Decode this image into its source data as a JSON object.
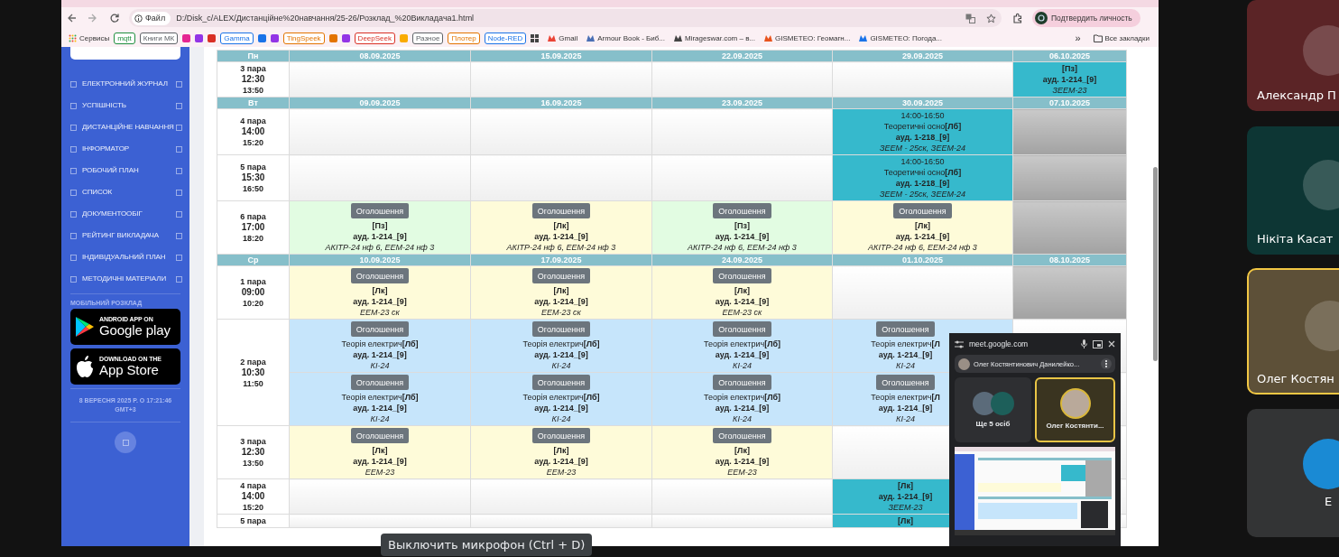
{
  "browser": {
    "address": {
      "chip": "Файл",
      "url": "D:/Disk_c/ALEX/Дистанційне%20навчання/25-26/Розклад_%20Викладача1.html"
    },
    "profile_button": "Подтвердить личность",
    "bookmarks": [
      {
        "kind": "apps",
        "label": "Сервисы"
      },
      {
        "kind": "chip",
        "label": "mqtt",
        "color": "#1e8e3e"
      },
      {
        "kind": "chip",
        "label": "Книги МК",
        "color": "#5f6368"
      },
      {
        "kind": "square",
        "color": "#e52592"
      },
      {
        "kind": "square",
        "color": "#9334e6"
      },
      {
        "kind": "square",
        "color": "#d93025"
      },
      {
        "kind": "chip",
        "label": "Gamma",
        "color": "#1a73e8"
      },
      {
        "kind": "square",
        "color": "#1a73e8"
      },
      {
        "kind": "square",
        "color": "#9334e6"
      },
      {
        "kind": "chip",
        "label": "TingSpeek",
        "color": "#e37400"
      },
      {
        "kind": "square",
        "color": "#e37400"
      },
      {
        "kind": "square",
        "color": "#9334e6"
      },
      {
        "kind": "chip",
        "label": "DeepSeek",
        "color": "#d93025"
      },
      {
        "kind": "square",
        "color": "#f9ab00"
      },
      {
        "kind": "chip",
        "label": "Разное",
        "color": "#5f6368"
      },
      {
        "kind": "chip",
        "label": "Плотер",
        "color": "#e37400"
      },
      {
        "kind": "chip",
        "label": "Node-RED",
        "color": "#1a73e8"
      },
      {
        "kind": "grid"
      },
      {
        "kind": "link",
        "label": "Gmail",
        "color": "#ea4335"
      },
      {
        "kind": "link",
        "label": "Armour Book - Биб...",
        "color": "#4a6fb5"
      },
      {
        "kind": "link",
        "label": "Mirageswar.com – в...",
        "color": "#444444"
      },
      {
        "kind": "link",
        "label": "GISMETEO: Геомагн...",
        "color": "#e8541e"
      },
      {
        "kind": "link",
        "label": "GISMETEO: Погода...",
        "color": "#1a73e8"
      }
    ],
    "overflow": "»",
    "all_bookmarks": "Все закладки"
  },
  "sidebar": {
    "items": [
      "ЕЛЕКТРОННИЙ ЖУРНАЛ",
      "УСПІШНІСТЬ",
      "ДИСТАНЦІЙНЕ НАВЧАННЯ",
      "ІНФОРМАТОР",
      "РОБОЧИЙ ПЛАН",
      "СПИСОК",
      "ДОКУМЕНТООБІГ",
      "РЕЙТИНГ ВИКЛАДАЧА",
      "ІНДИВІДУАЛЬНИЙ ПЛАН",
      "МЕТОДИЧНІ МАТЕРІАЛИ"
    ],
    "mobile_heading": "МОБІЛЬНИЙ РОЗКЛАД",
    "badges": [
      {
        "kind": "google",
        "small": "ANDROID APP ON",
        "big": "Google play"
      },
      {
        "kind": "apple",
        "small": "DOWNLOAD ON THE",
        "big": "App Store"
      }
    ],
    "datetime": [
      "8 ВЕРЕСНЯ 2025 Р. О 17:21:46",
      "GMT+3"
    ]
  },
  "table": {
    "sections": [
      {
        "day": "Пн",
        "dates": [
          "08.09.2025",
          "15.09.2025",
          "22.09.2025",
          "29.09.2025",
          "06.10.2025"
        ],
        "rows": [
          {
            "label": [
              "3 пара",
              "12:30",
              "13:50"
            ],
            "cells": [
              {
                "kind": "empty"
              },
              {
                "kind": "empty"
              },
              {
                "kind": "empty"
              },
              {
                "kind": "empty"
              },
              {
                "kind": "lesson",
                "color": "#36b9cc",
                "type": "[Пз]",
                "room": "ауд. 1-214_[9]",
                "group": "ЗЕЕМ-23"
              }
            ]
          }
        ]
      },
      {
        "day": "Вт",
        "dates": [
          "09.09.2025",
          "16.09.2025",
          "23.09.2025",
          "30.09.2025",
          "07.10.2025"
        ],
        "rows": [
          {
            "label": [
              "4 пара",
              "14:00",
              "15:20"
            ],
            "cells": [
              {
                "kind": "empty"
              },
              {
                "kind": "empty"
              },
              {
                "kind": "empty"
              },
              {
                "kind": "lesson",
                "color": "#36b9cc",
                "time": "14:00-16:50",
                "title": "Теоретичні осно",
                "type": "[Лб]",
                "room": "ауд. 1-218_[9]",
                "group": "ЗЕЕМ - 25ск, ЗЕЕМ-24"
              },
              {
                "kind": "blocked"
              }
            ]
          },
          {
            "label": [
              "5 пара",
              "15:30",
              "16:50"
            ],
            "cells": [
              {
                "kind": "empty"
              },
              {
                "kind": "empty"
              },
              {
                "kind": "empty"
              },
              {
                "kind": "lesson",
                "color": "#36b9cc",
                "time": "14:00-16:50",
                "title": "Теоретичні осно",
                "type": "[Лб]",
                "room": "ауд. 1-218_[9]",
                "group": "ЗЕЕМ - 25ск, ЗЕЕМ-24"
              },
              {
                "kind": "blocked"
              }
            ]
          },
          {
            "label": [
              "6 пара",
              "17:00",
              "18:20"
            ],
            "cells": [
              {
                "kind": "lesson",
                "color": "#e2fce2",
                "button": "Оголошення",
                "type": "[Пз]",
                "room": "ауд. 1-214_[9]",
                "group": "АКІТР-24 нф 6, ЕЕМ-24 нф 3"
              },
              {
                "kind": "lesson",
                "color": "#fefbd9",
                "button": "Оголошення",
                "type": "[Лк]",
                "room": "ауд. 1-214_[9]",
                "group": "АКІТР-24 нф 6, ЕЕМ-24 нф 3"
              },
              {
                "kind": "lesson",
                "color": "#e2fce2",
                "button": "Оголошення",
                "type": "[Пз]",
                "room": "ауд. 1-214_[9]",
                "group": "АКІТР-24 нф 6, ЕЕМ-24 нф 3"
              },
              {
                "kind": "lesson",
                "color": "#fefbd9",
                "button": "Оголошення",
                "type": "[Лк]",
                "room": "ауд. 1-214_[9]",
                "group": "АКІТР-24 нф 6, ЕЕМ-24 нф 3"
              },
              {
                "kind": "blocked"
              }
            ]
          }
        ]
      },
      {
        "day": "Ср",
        "dates": [
          "10.09.2025",
          "17.09.2025",
          "24.09.2025",
          "01.10.2025",
          "08.10.2025"
        ],
        "rows": [
          {
            "label": [
              "1 пара",
              "09:00",
              "10:20"
            ],
            "cells": [
              {
                "kind": "lesson",
                "color": "#fefbd9",
                "button": "Оголошення",
                "type": "[Лк]",
                "room": "ауд. 1-214_[9]",
                "group": "ЕЕМ-23 ск"
              },
              {
                "kind": "lesson",
                "color": "#fefbd9",
                "button": "Оголошення",
                "type": "[Лк]",
                "room": "ауд. 1-214_[9]",
                "group": "ЕЕМ-23 ск"
              },
              {
                "kind": "lesson",
                "color": "#fefbd9",
                "button": "Оголошення",
                "type": "[Лк]",
                "room": "ауд. 1-214_[9]",
                "group": "ЕЕМ-23 ск"
              },
              {
                "kind": "empty"
              },
              {
                "kind": "blocked"
              }
            ]
          },
          {
            "label": [
              "2 пара",
              "10:30",
              "11:50"
            ],
            "cells": [
              {
                "kind": "lesson",
                "color": "#c6e5fb",
                "button": "Оголошення",
                "title": "Теорія електрич",
                "type": "[Лб]",
                "room": "ауд. 1-214_[9]",
                "group": "КІ-24"
              },
              {
                "kind": "lesson",
                "color": "#c6e5fb",
                "button": "Оголошення",
                "title": "Теорія електрич",
                "type": "[Лб]",
                "room": "ауд. 1-214_[9]",
                "group": "КІ-24"
              },
              {
                "kind": "lesson",
                "color": "#c6e5fb",
                "button": "Оголошення",
                "title": "Теорія електрич",
                "type": "[Лб]",
                "room": "ауд. 1-214_[9]",
                "group": "КІ-24"
              },
              {
                "kind": "lesson",
                "color": "#c6e5fb",
                "button": "Оголошення",
                "title": "Теорія електрич",
                "type": "[Л",
                "room": "ауд. 1-214_[9]",
                "group": "КІ-24"
              },
              {
                "kind": "empty"
              }
            ]
          },
          {
            "cells": [
              {
                "kind": "lesson",
                "color": "#c6e5fb",
                "button": "Оголошення",
                "title": "Теорія електрич",
                "type": "[Лб]",
                "room": "ауд. 1-214_[9]",
                "group": "КІ-24"
              },
              {
                "kind": "lesson",
                "color": "#c6e5fb",
                "button": "Оголошення",
                "title": "Теорія електрич",
                "type": "[Лб]",
                "room": "ауд. 1-214_[9]",
                "group": "КІ-24"
              },
              {
                "kind": "lesson",
                "color": "#c6e5fb",
                "button": "Оголошення",
                "title": "Теорія електрич",
                "type": "[Лб]",
                "room": "ауд. 1-214_[9]",
                "group": "КІ-24"
              },
              {
                "kind": "lesson",
                "color": "#c6e5fb",
                "button": "Оголошення",
                "title": "Теорія електрич",
                "type": "[Л",
                "room": "ауд. 1-214_[9]",
                "group": "КІ-24"
              },
              {
                "kind": "empty"
              }
            ]
          },
          {
            "label": [
              "3 пара",
              "12:30",
              "13:50"
            ],
            "cells": [
              {
                "kind": "lesson",
                "color": "#fefbd9",
                "button": "Оголошення",
                "type": "[Лк]",
                "room": "ауд. 1-214_[9]",
                "group": "ЕЕМ-23"
              },
              {
                "kind": "lesson",
                "color": "#fefbd9",
                "button": "Оголошення",
                "type": "[Лк]",
                "room": "ауд. 1-214_[9]",
                "group": "ЕЕМ-23"
              },
              {
                "kind": "lesson",
                "color": "#fefbd9",
                "button": "Оголошення",
                "type": "[Лк]",
                "room": "ауд. 1-214_[9]",
                "group": "ЕЕМ-23"
              },
              {
                "kind": "empty"
              },
              {
                "kind": "empty"
              }
            ]
          },
          {
            "label": [
              "4 пара",
              "14:00",
              "15:20"
            ],
            "cells": [
              {
                "kind": "empty"
              },
              {
                "kind": "empty"
              },
              {
                "kind": "empty"
              },
              {
                "kind": "lesson",
                "color": "#36b9cc",
                "type": "[Лк]",
                "room": "ауд. 1-214_[9]",
                "group": "ЗЕЕМ-23"
              },
              {
                "kind": "empty"
              }
            ]
          },
          {
            "label": [
              "5 пара"
            ],
            "cells": [
              {
                "kind": "empty"
              },
              {
                "kind": "empty"
              },
              {
                "kind": "empty"
              },
              {
                "kind": "lesson",
                "color": "#36b9cc",
                "type": "[Лк]"
              },
              {
                "kind": "empty"
              }
            ]
          }
        ]
      }
    ]
  },
  "meet_popup": {
    "site": "meet.google.com",
    "presenter": "Олег Костянтинович Данилейко...",
    "tiles": [
      {
        "kind": "group",
        "label": "Ще 5 осіб",
        "speaking": false
      },
      {
        "kind": "person",
        "label": "Олег Костянти...",
        "speaking": true
      }
    ]
  },
  "participants": [
    {
      "name": "Александр П",
      "color": "#5b2426",
      "speaking": false
    },
    {
      "name": "Нікіта Касат",
      "color": "#0d3634",
      "speaking": false
    },
    {
      "name": "Олег Костян",
      "color": "#5d5038",
      "speaking": true
    },
    {
      "name": "Е",
      "color": "#333435",
      "speaking": false
    }
  ],
  "tooltip": "Выключить микрофон (Ctrl + D)"
}
